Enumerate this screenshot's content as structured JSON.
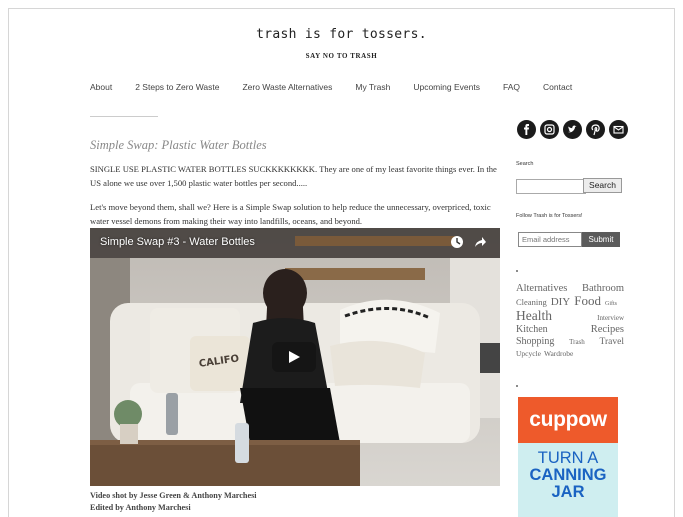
{
  "site": {
    "title": "trash is for tossers.",
    "tagline": "SAY NO TO TRASH"
  },
  "nav": {
    "items": [
      "About",
      "2 Steps to Zero Waste",
      "Zero Waste Alternatives",
      "My Trash",
      "Upcoming Events",
      "FAQ",
      "Contact"
    ]
  },
  "post": {
    "title": "Simple Swap: Plastic Water Bottles",
    "paragraph1": "SINGLE USE PLASTIC WATER BOTTLES SUCKKKKKKKK. They are one of my least favorite things ever. In the US alone we use over 1,500 plastic water bottles per second.....",
    "paragraph2": "Let's move beyond them, shall we? Here is a Simple Swap solution to help reduce the unnecessary, overpriced, toxic water vessel demons from making their way into landfills, oceans, and beyond.",
    "video_title": "Simple Swap #3 - Water Bottles",
    "video_pillow_text": "CALIFO",
    "credit_line1": "Video shot by Jesse Green & Anthony Marchesi",
    "credit_line2": "Edited by Anthony Marchesi"
  },
  "sidebar": {
    "social_icons": [
      "facebook-icon",
      "instagram-icon",
      "twitter-icon",
      "pinterest-icon",
      "email-icon"
    ],
    "search_title": "Search",
    "search_button": "Search",
    "search_value": "",
    "follow_title": "Follow Trash is for Tossers!",
    "email_placeholder": "Email address",
    "submit_button": "Submit",
    "tags": {
      "alternatives": "Alternatives",
      "bathroom": "Bathroom",
      "cleaning": "Cleaning",
      "diy": "DIY",
      "food": "Food",
      "gifts": "Gifts",
      "health": "Health",
      "interview": "Interview",
      "kitchen": "Kitchen",
      "recipes": "Recipes",
      "shopping": "Shopping",
      "trash": "Trash",
      "travel": "Travel",
      "upcycle": "Upcycle",
      "wardrobe": "Wardrobe"
    },
    "ad": {
      "brand": "cuppow",
      "line1": "TURN A",
      "line2": "CANNING",
      "line3": "JAR"
    }
  },
  "colors": {
    "accent_orange": "#ee5a2b",
    "ad_blue": "#1a63c2",
    "ad_bg": "#cfeef0",
    "post_title_grey": "#888888",
    "submit_grey": "#5b5b5b"
  }
}
